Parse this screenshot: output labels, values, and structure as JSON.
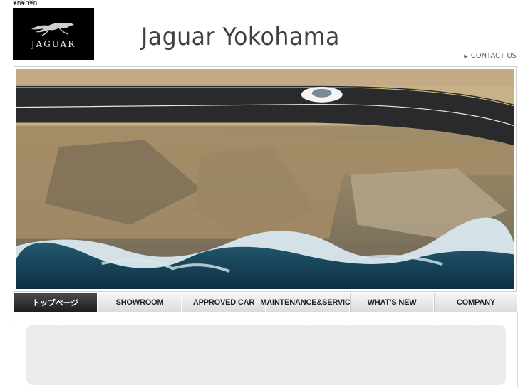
{
  "artifact_text": "¥n¥n¥n",
  "logo": {
    "text": "JAGUAR"
  },
  "site": {
    "title": "Jaguar Yokohama"
  },
  "header": {
    "contact_label": "CONTACT US"
  },
  "nav": {
    "items": [
      {
        "label": "トップページ",
        "active": true
      },
      {
        "label": "SHOWROOM",
        "active": false
      },
      {
        "label": "APPROVED CAR",
        "active": false
      },
      {
        "label": "MAINTENANCE&SERVICE",
        "active": false
      },
      {
        "label": "WHAT'S NEW",
        "active": false
      },
      {
        "label": "COMPANY",
        "active": false
      }
    ]
  },
  "colors": {
    "logo_bg": "#000000",
    "nav_active": "#2b2b2b",
    "nav_bg": "#e6e6e6",
    "panel_bg": "#ececef"
  }
}
